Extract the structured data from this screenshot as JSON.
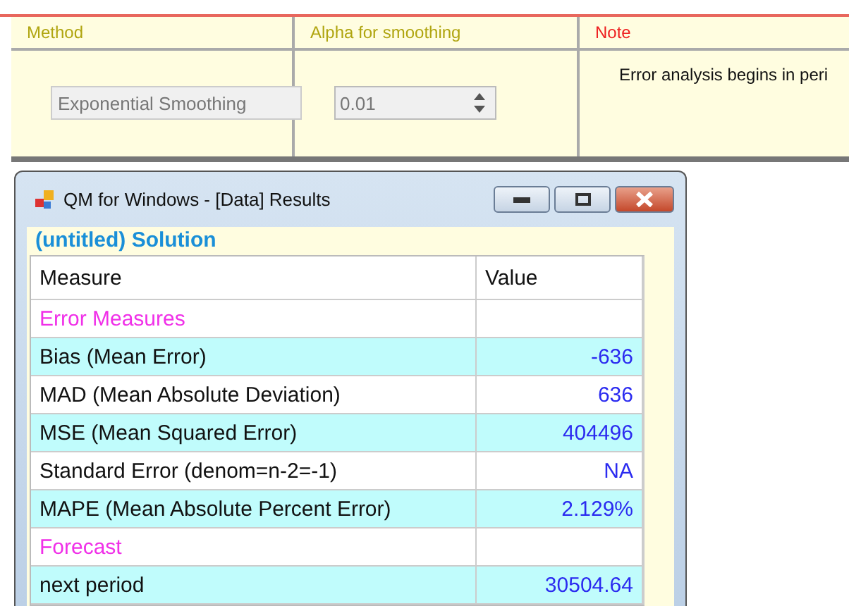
{
  "groups": [
    {
      "kind": "method",
      "label": "Method",
      "value": "Exponential Smoothing"
    },
    {
      "kind": "alpha",
      "label": "Alpha for smoothing",
      "value": "0.01"
    },
    {
      "kind": "note",
      "label": "Note",
      "value": "Error analysis begins in peri"
    }
  ],
  "window": {
    "title": "QM for Windows - [Data] Results",
    "heading": "(untitled) Solution"
  },
  "table": {
    "columns": [
      "Measure",
      "Value"
    ],
    "rows": [
      {
        "kind": "section",
        "measure": "Error Measures",
        "shaded": false
      },
      {
        "kind": "value",
        "measure": "Bias (Mean Error)",
        "value": "-636",
        "shaded": true
      },
      {
        "kind": "value",
        "measure": "MAD (Mean Absolute Deviation)",
        "value": "636",
        "shaded": false
      },
      {
        "kind": "value",
        "measure": "MSE (Mean Squared Error)",
        "value": "404496",
        "shaded": true
      },
      {
        "kind": "value",
        "measure": "Standard Error (denom=n-2=-1)",
        "value": "NA",
        "shaded": false
      },
      {
        "kind": "value",
        "measure": "MAPE (Mean Absolute Percent Error)",
        "value": "2.129%",
        "shaded": true
      },
      {
        "kind": "section",
        "measure": "Forecast",
        "shaded": false
      },
      {
        "kind": "value",
        "measure": "next period",
        "value": "30504.64",
        "shaded": true
      }
    ]
  }
}
